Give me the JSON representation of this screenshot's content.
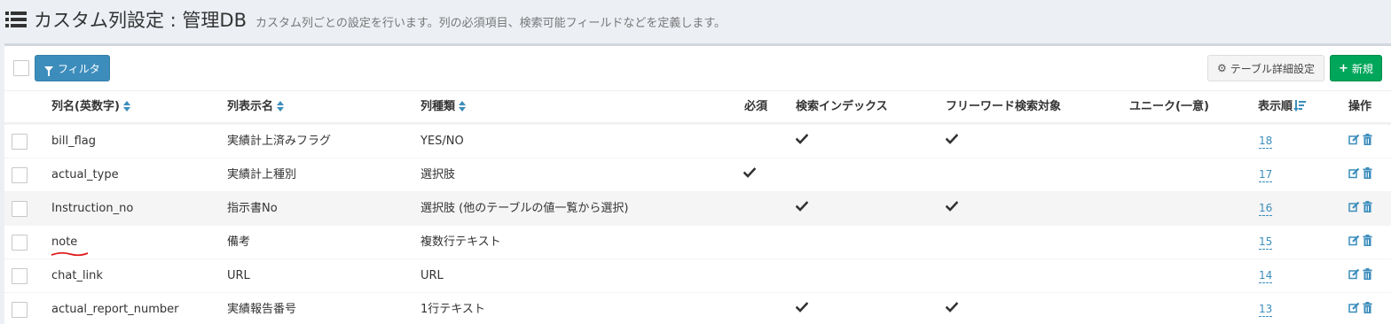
{
  "header": {
    "title": "カスタム列設定 : 管理DB",
    "subtitle": "カスタム列ごとの設定を行います。列の必須項目、検索可能フィールドなどを定義します。",
    "icon": "list-icon"
  },
  "toolbar": {
    "filter_label": "フィルタ",
    "table_settings_label": "テーブル詳細設定",
    "new_label": "新規"
  },
  "columns": {
    "name": "列名(英数字)",
    "display_name": "列表示名",
    "type": "列種類",
    "required": "必須",
    "search_index": "検索インデックス",
    "freeword": "フリーワード検索対象",
    "unique": "ユニーク(一意)",
    "order": "表示順",
    "actions": "操作"
  },
  "rows": [
    {
      "name": "bill_flag",
      "display_name": "実績計上済みフラグ",
      "type": "YES/NO",
      "required": false,
      "search_index": true,
      "freeword": true,
      "unique": false,
      "order": "18"
    },
    {
      "name": "actual_type",
      "display_name": "実績計上種別",
      "type": "選択肢",
      "required": true,
      "search_index": false,
      "freeword": false,
      "unique": false,
      "order": "17"
    },
    {
      "name": "Instruction_no",
      "display_name": "指示書No",
      "type": "選択肢 (他のテーブルの値一覧から選択)",
      "required": false,
      "search_index": true,
      "freeword": true,
      "unique": false,
      "order": "16"
    },
    {
      "name": "note",
      "display_name": "備考",
      "type": "複数行テキスト",
      "required": false,
      "search_index": false,
      "freeword": false,
      "unique": false,
      "order": "15",
      "annotated": true
    },
    {
      "name": "chat_link",
      "display_name": "URL",
      "type": "URL",
      "required": false,
      "search_index": false,
      "freeword": false,
      "unique": false,
      "order": "14"
    },
    {
      "name": "actual_report_number",
      "display_name": "実績報告番号",
      "type": "1行テキスト",
      "required": false,
      "search_index": true,
      "freeword": true,
      "unique": false,
      "order": "13"
    }
  ],
  "colors": {
    "primary": "#3c8dbc",
    "success": "#00a65a",
    "annotation": "#e0191b"
  }
}
